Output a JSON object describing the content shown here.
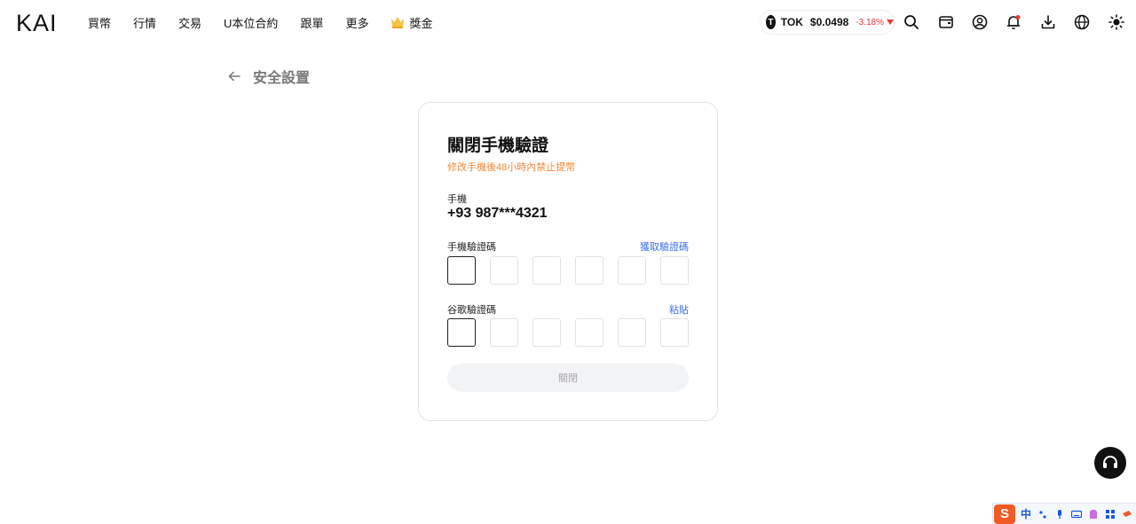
{
  "header": {
    "logo_text": "KAI",
    "nav": [
      "買幣",
      "行情",
      "交易",
      "U本位合約",
      "跟單",
      "更多"
    ],
    "reward_label": "獎金",
    "ticker": {
      "icon_letter": "T",
      "symbol": "TOK",
      "price": "$0.0498",
      "change": "-3.18%"
    }
  },
  "page": {
    "back_title": "安全設置"
  },
  "card": {
    "title": "關閉手機驗證",
    "warning": "修改手機後48小時內禁止提幣",
    "phone_label": "手機",
    "phone_value": "+93 987***4321",
    "sms_code_label": "手機驗證碼",
    "sms_code_link": "獲取驗證碼",
    "google_code_label": "谷歌驗證碼",
    "google_code_link": "粘貼",
    "code_length": 6,
    "submit_label": "關閉"
  },
  "ime": {
    "logo": "S",
    "lang": "中"
  },
  "colors": {
    "accent_link": "#3b6ff5",
    "warning": "#f08a3c",
    "negative": "#e5383b"
  }
}
